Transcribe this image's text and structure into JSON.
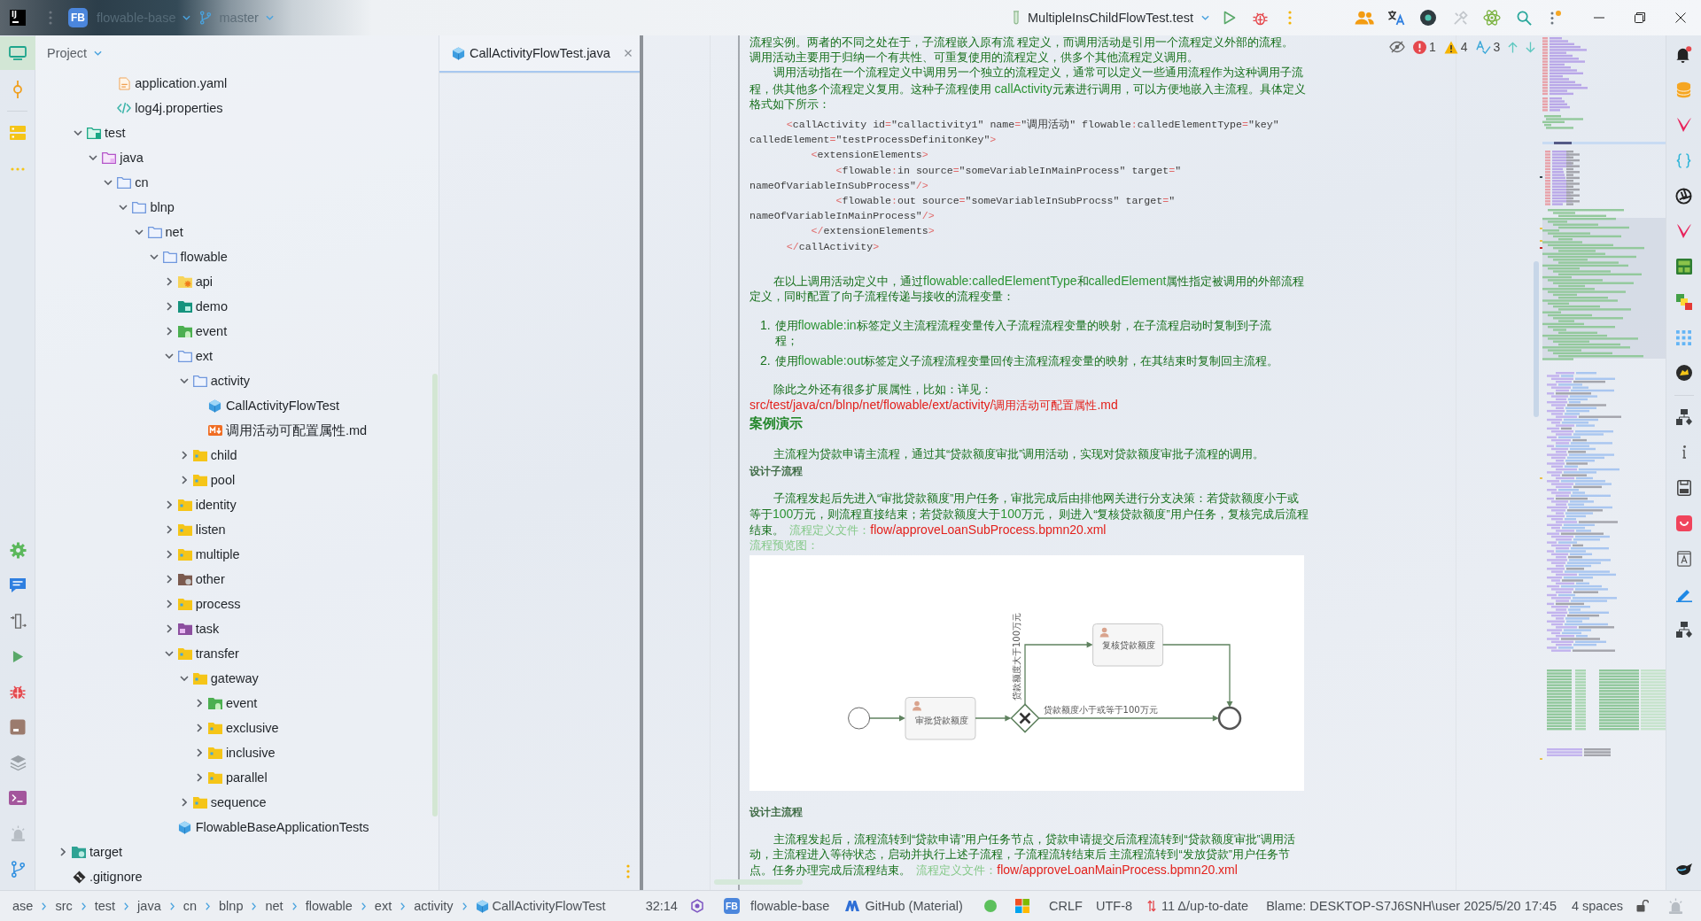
{
  "title_bar": {
    "logo": "IJ",
    "project_badge": "FB",
    "project": "flowable-base",
    "branch": "master",
    "run_configuration": "MultipleInsChildFlowTest.test"
  },
  "left_toolbar": {
    "top": [
      {
        "kind": "project",
        "selected": true
      },
      {
        "kind": "commit",
        "selected": false
      },
      {
        "kind": "structure",
        "selected": false
      },
      {
        "kind": "more",
        "selected": false
      }
    ],
    "bottom": [
      {
        "kind": "services",
        "selected": false
      },
      {
        "kind": "chat",
        "selected": false
      },
      {
        "kind": "endpoints",
        "selected": false
      },
      {
        "kind": "run",
        "selected": false
      },
      {
        "kind": "debug",
        "selected": false
      },
      {
        "kind": "build",
        "selected": false
      },
      {
        "kind": "layers",
        "selected": false
      },
      {
        "kind": "terminal",
        "selected": false
      },
      {
        "kind": "problems",
        "selected": false
      },
      {
        "kind": "git",
        "selected": false
      }
    ]
  },
  "project_panel": {
    "title": "Project",
    "tree": [
      {
        "children": [
          {
            "children": [
              {
                "children": [
                  {
                    "label": "application.yaml",
                    "kind": "yaml"
                  },
                  {
                    "label": "log4j.properties",
                    "kind": "properties"
                  }
                ]
              }
            ]
          },
          {
            "label": "test",
            "kind": "testroot",
            "expanded": true,
            "children": [
              {
                "label": "java",
                "kind": "sourceroot",
                "expanded": true,
                "children": [
                  {
                    "label": "cn",
                    "kind": "package",
                    "expanded": true,
                    "children": [
                      {
                        "label": "blnp",
                        "kind": "package",
                        "expanded": true,
                        "children": [
                          {
                            "label": "net",
                            "kind": "package",
                            "expanded": true,
                            "children": [
                              {
                                "label": "flowable",
                                "kind": "package",
                                "expanded": true,
                                "children": [
                                  {
                                    "label": "api",
                                    "kind": "api",
                                    "expanded": false
                                  },
                                  {
                                    "label": "demo",
                                    "kind": "demo",
                                    "expanded": false
                                  },
                                  {
                                    "label": "event",
                                    "kind": "event",
                                    "expanded": false
                                  },
                                  {
                                    "label": "ext",
                                    "kind": "package",
                                    "expanded": true,
                                    "children": [
                                      {
                                        "label": "activity",
                                        "kind": "package",
                                        "expanded": true,
                                        "children": [
                                          {
                                            "label": "CallActivityFlowTest",
                                            "kind": "class"
                                          },
                                          {
                                            "label": "调用活动可配置属性.md",
                                            "kind": "markdown"
                                          }
                                        ]
                                      },
                                      {
                                        "label": "child",
                                        "kind": "folder",
                                        "expanded": false
                                      },
                                      {
                                        "label": "pool",
                                        "kind": "folder",
                                        "expanded": false
                                      }
                                    ]
                                  },
                                  {
                                    "label": "identity",
                                    "kind": "folder",
                                    "expanded": false
                                  },
                                  {
                                    "label": "listen",
                                    "kind": "folder",
                                    "expanded": false
                                  },
                                  {
                                    "label": "multiple",
                                    "kind": "folder",
                                    "expanded": false
                                  },
                                  {
                                    "label": "other",
                                    "kind": "other",
                                    "expanded": false
                                  },
                                  {
                                    "label": "process",
                                    "kind": "folder",
                                    "expanded": false
                                  },
                                  {
                                    "label": "task",
                                    "kind": "task",
                                    "expanded": false
                                  },
                                  {
                                    "label": "transfer",
                                    "kind": "folder",
                                    "expanded": true,
                                    "children": [
                                      {
                                        "label": "gateway",
                                        "kind": "folder",
                                        "expanded": true,
                                        "children": [
                                          {
                                            "label": "event",
                                            "kind": "event",
                                            "expanded": false
                                          },
                                          {
                                            "label": "exclusive",
                                            "kind": "folder",
                                            "expanded": false
                                          },
                                          {
                                            "label": "inclusive",
                                            "kind": "folder",
                                            "expanded": false
                                          },
                                          {
                                            "label": "parallel",
                                            "kind": "folder",
                                            "expanded": false
                                          }
                                        ]
                                      },
                                      {
                                        "label": "sequence",
                                        "kind": "folder",
                                        "expanded": false
                                      }
                                    ]
                                  },
                                  {
                                    "label": "FlowableBaseApplicationTests",
                                    "kind": "class"
                                  }
                                ]
                              }
                            ]
                          }
                        ]
                      }
                    ]
                  }
                ]
              }
            ]
          }
        ]
      },
      {
        "label": "target",
        "kind": "excluded",
        "expanded": false
      },
      {
        "label": ".gitignore",
        "kind": "gitignore"
      }
    ]
  },
  "editor": {
    "tabs": [
      {
        "label": "CallActivityFlowTest.java",
        "selected": true
      }
    ]
  },
  "inspections": {
    "errors": "1",
    "warnings": "4",
    "typos": "3"
  },
  "preview": {
    "blocks": [
      {
        "kind": "line",
        "parts": [
          {
            "kind": "text",
            "text": "流程实例。两者的不同之处在于，子流程嵌入原有流 程定义，而调用活动是引用一个流程定义外部的流程。"
          }
        ]
      },
      {
        "kind": "line",
        "parts": [
          {
            "kind": "text",
            "text": "调用活动主要用于归纳一个有共性、可重复使用的流程定义，供多个其他流程定义调用。"
          }
        ]
      },
      {
        "kind": "paragraph",
        "parts": [
          {
            "kind": "text",
            "text": "调用活动指在一个流程定义中调用另一个独立的流程定义，通常可以定义一些通用流程作为这种调用子流程，供其他多个流程定义复用。这种子流程使用 callActivity元素进行调用，可以方便地嵌入主流程。具体定义格式如下所示："
          }
        ]
      },
      {
        "kind": "code",
        "lines": [
          "      <callActivity id=\"callactivity1\" name=\"调用活动\" flowable:calledElementType=\"key\"",
          "calledElement=\"testProcessDefinitonKey\">",
          "          <extensionElements>",
          "              <flowable:in source=\"someVariableInMainProcess\" target=\"",
          "nameOfVariableInSubProcess\"/>",
          "              <flowable:out source=\"someVariableInSubProcss\" target=\"",
          "nameOfVariableInMainProcess\"/>",
          "          </extensionElements>",
          "      </callActivity>"
        ]
      },
      {
        "kind": "paragraph",
        "parts": [
          {
            "kind": "text",
            "text": "在以上调用活动定义中，通过flowable:calledElementType和calledElement属性指定被调用的外部流程定义，同时配置了向子流程传递与接收的流程变量："
          }
        ]
      },
      {
        "kind": "list",
        "items": [
          {
            "number": "1.",
            "parts": [
              {
                "kind": "text",
                "text": "使用flowable:in标签定义主流程流程变量传入子流程流程变量的映射，在子流程启动时复制到子流程；"
              }
            ]
          },
          {
            "number": "2.",
            "parts": [
              {
                "kind": "text",
                "text": "使用flowable:out标签定义子流程流程变量回传主流程流程变量的映射，在其结束时复制回主流程。"
              }
            ]
          }
        ]
      },
      {
        "kind": "paragraph",
        "parts": [
          {
            "kind": "text",
            "text": "除此之外还有很多扩展属性，比如：详见："
          },
          {
            "kind": "link",
            "text": "src/test/java/cn/blnp/net/flowable/ext/activity/调用活动可配置属性.md"
          }
        ]
      },
      {
        "kind": "heading",
        "text": "案例演示"
      },
      {
        "kind": "paragraph",
        "parts": [
          {
            "kind": "text",
            "text": "主流程为贷款申请主流程，通过其“贷款额度审批”调用活动，实现对贷款额度审批子流程的调用。"
          }
        ]
      },
      {
        "kind": "subheading",
        "text": "设计子流程"
      },
      {
        "kind": "paragraph",
        "parts": [
          {
            "kind": "text",
            "text": "子流程发起后先进入“审批贷款额度”用户任务，审批完成后由排他网关进行分支决策：若贷款额度小于或等于100万元，则流程直接结束；若贷款额度大于100万元， 则进入“复核贷款额度”用户任务，复核完成后流程结束。"
          },
          {
            "kind": "note",
            "text": "流程定义文件："
          },
          {
            "kind": "link",
            "text": "flow/approveLoanSubProcess.bpmn20.xml"
          }
        ]
      },
      {
        "kind": "caption",
        "text": "流程预览图："
      },
      {
        "kind": "diagram",
        "tasks": [
          "审批贷款额度",
          "复核贷款额度"
        ],
        "conditions": [
          "贷款额度大于100万元",
          "贷款额度小于或等于100万元"
        ]
      },
      {
        "kind": "subheading",
        "text": "设计主流程"
      },
      {
        "kind": "paragraph",
        "parts": [
          {
            "kind": "text",
            "text": "主流程发起后，流程流转到“贷款申请”用户任务节点，贷款申请提交后流程流转到“贷款额度审批”调用活动，主流程进入等待状态，启动并执行上述子流程，子流程流转结束后 主流程流转到“发放贷款”用户任务节点。任务办理完成后流程结束。"
          },
          {
            "kind": "note",
            "text": "流程定义文件："
          },
          {
            "kind": "link",
            "text": "flow/approveLoanMainProcess.bpmn20.xml"
          }
        ]
      }
    ]
  },
  "status_bar": {
    "breadcrumbs": [
      {
        "label": "ase",
        "kind": "folder"
      },
      {
        "label": "src",
        "kind": "folder"
      },
      {
        "label": "test",
        "kind": "folder"
      },
      {
        "label": "java",
        "kind": "folder"
      },
      {
        "label": "cn",
        "kind": "folder"
      },
      {
        "label": "blnp",
        "kind": "folder"
      },
      {
        "label": "net",
        "kind": "folder"
      },
      {
        "label": "flowable",
        "kind": "folder"
      },
      {
        "label": "ext",
        "kind": "folder"
      },
      {
        "label": "activity",
        "kind": "folder"
      },
      {
        "label": "CallActivityFlowTest",
        "kind": "class"
      }
    ],
    "caret": "32:14",
    "project_badge": "FB",
    "project": "flowable-base",
    "theme": "GitHub (Material)",
    "line_separator": "CRLF",
    "encoding": "UTF-8",
    "vcs": "11 Δ/up-to-date",
    "blame": "Blame: DESKTOP-S7J6SNH\\user 2025/5/20 17:45",
    "indent": "4 spaces"
  }
}
